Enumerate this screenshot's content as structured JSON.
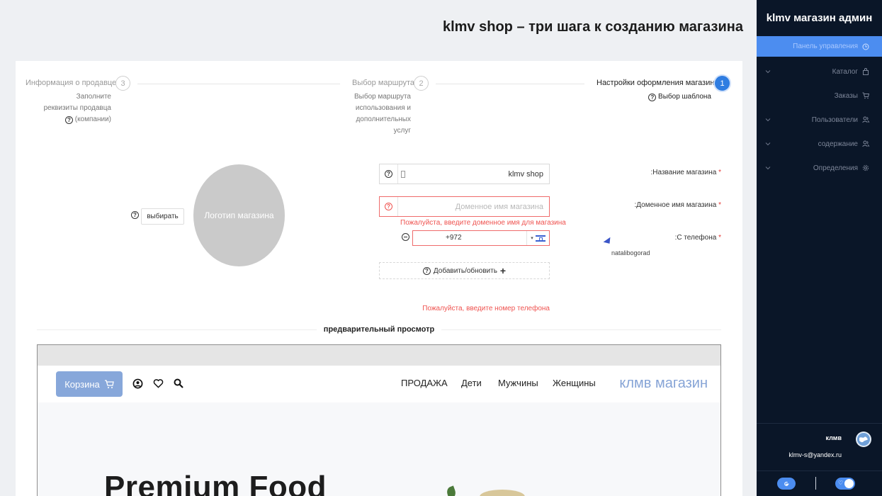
{
  "page": {
    "title": "klmv shop – три шага к созданию магазина"
  },
  "sidebar": {
    "title": "klmv магазин админ",
    "items": [
      {
        "label": "Панель управления",
        "icon": "clock-icon",
        "active": true,
        "expandable": false
      },
      {
        "label": "Каталог",
        "icon": "bag-icon",
        "active": false,
        "expandable": true
      },
      {
        "label": "Заказы",
        "icon": "cart-icon",
        "active": false,
        "expandable": false
      },
      {
        "label": "Пользователи",
        "icon": "users-icon",
        "active": false,
        "expandable": true
      },
      {
        "label": "содержание",
        "icon": "users-icon",
        "active": false,
        "expandable": true
      },
      {
        "label": "Определения",
        "icon": "gear-icon",
        "active": false,
        "expandable": true
      }
    ],
    "user": {
      "name": "клмв",
      "email": "klmv-s@yandex.ru"
    },
    "colors": {
      "background": "#0a1628",
      "accent": "#4c8df0"
    }
  },
  "steps": [
    {
      "number": "3",
      "label": "Информация о продавце",
      "desc_lines": [
        "Заполните",
        "реквизиты продавца",
        "(компании)"
      ],
      "active": false
    },
    {
      "number": "2",
      "label": "Выбор маршрута",
      "desc_lines": [
        "Выбор маршрута",
        "использования и",
        "дополнительных",
        "услуг"
      ],
      "active": false
    },
    {
      "number": "1",
      "label": "Настройки оформления магазина",
      "desc_lines": [
        "Выбор шаблона"
      ],
      "active": true
    }
  ],
  "logo": {
    "placeholder": "Логотип магазина",
    "pick_button": "выбирать"
  },
  "form": {
    "store_name": {
      "label": ":Название магазина",
      "value": "klmv shop"
    },
    "domain": {
      "label": ":Доменное имя магазина",
      "placeholder": "Доменное имя магазина",
      "error": "Пожалуйста, введите доменное имя для магазина"
    },
    "phone": {
      "label": ":С телефона",
      "value": "+972",
      "country": "Israel",
      "error": "Пожалуйста, введите номер телефона"
    },
    "add_button": "Добавить/обновить",
    "required_mark": "*"
  },
  "cursor_user": "natalibogorad",
  "preview": {
    "title": "предварительный просмотр",
    "cart_label": "Корзина",
    "nav_links": [
      "ПРОДАЖА",
      "Дети",
      "Мужчины",
      "Женщины"
    ],
    "brand": "клмв магазин",
    "hero_text": "Premium Food",
    "colors": {
      "cart": "#87a7da",
      "brand": "#86a4d6"
    }
  },
  "colors": {
    "error": "#ef5350",
    "primary": "#2f7de1"
  }
}
